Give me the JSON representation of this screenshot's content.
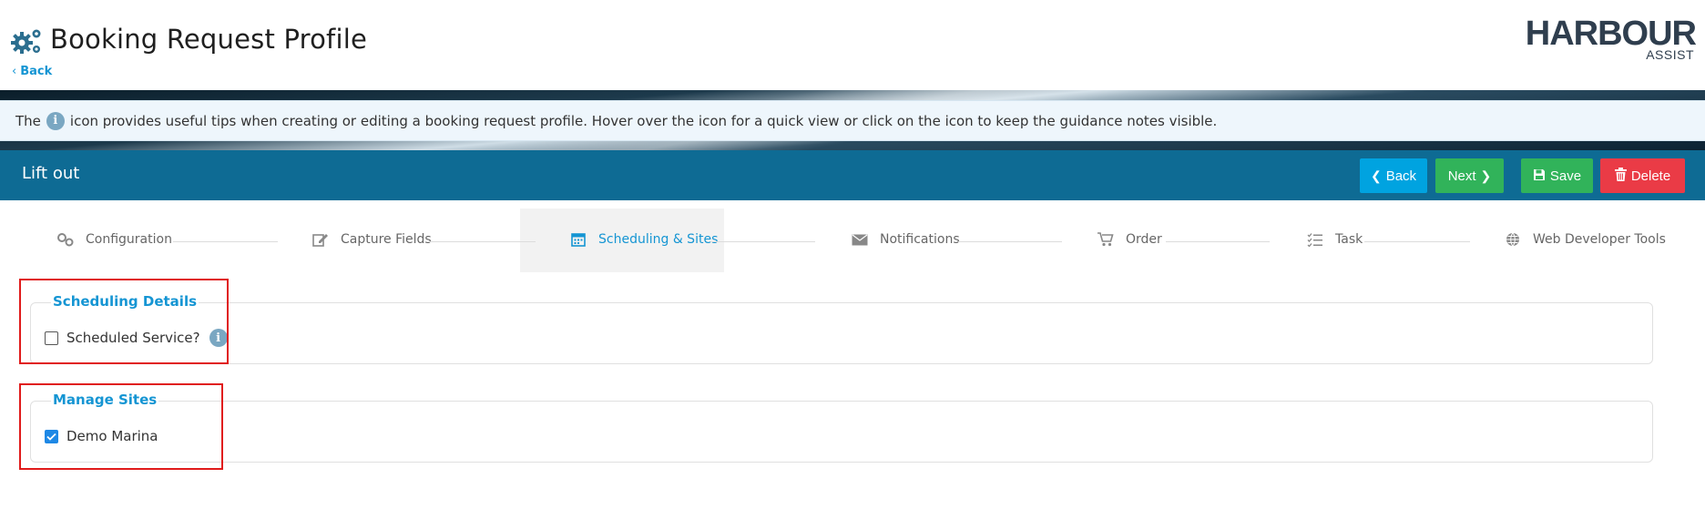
{
  "header": {
    "title": "Booking Request Profile",
    "back_label": "Back",
    "logo_main": "HARBOUR",
    "logo_sub": "ASSIST"
  },
  "info_banner": {
    "text_before": "The",
    "icon_glyph": "i",
    "text_after": "icon provides useful tips when creating or editing a booking request profile. Hover over the icon for a quick view or click on the icon to keep the guidance notes visible."
  },
  "titlebar": {
    "title": "Lift out",
    "buttons": {
      "back": "Back",
      "next": "Next",
      "save": "Save",
      "delete": "Delete"
    }
  },
  "steps": [
    {
      "label": "Configuration",
      "icon": "cogs-icon",
      "active": false
    },
    {
      "label": "Capture Fields",
      "icon": "edit-icon",
      "active": false
    },
    {
      "label": "Scheduling & Sites",
      "icon": "calendar-icon",
      "active": true
    },
    {
      "label": "Notifications",
      "icon": "envelope-icon",
      "active": false
    },
    {
      "label": "Order",
      "icon": "cart-icon",
      "active": false
    },
    {
      "label": "Task",
      "icon": "checklist-icon",
      "active": false
    },
    {
      "label": "Web Developer Tools",
      "icon": "globe-icon",
      "active": false
    }
  ],
  "scheduling_details": {
    "legend": "Scheduling Details",
    "scheduled_service_label": "Scheduled Service?",
    "scheduled_service_checked": false,
    "help_glyph": "i"
  },
  "manage_sites": {
    "legend": "Manage Sites",
    "sites": [
      {
        "label": "Demo Marina",
        "checked": true
      }
    ]
  },
  "colors": {
    "titlebar": "#0e6b94",
    "accent_blue": "#1595d3",
    "btn_back": "#00a3e0",
    "btn_green": "#31b35a",
    "btn_delete": "#ea3b46",
    "annotation_red": "#e01b1b"
  }
}
